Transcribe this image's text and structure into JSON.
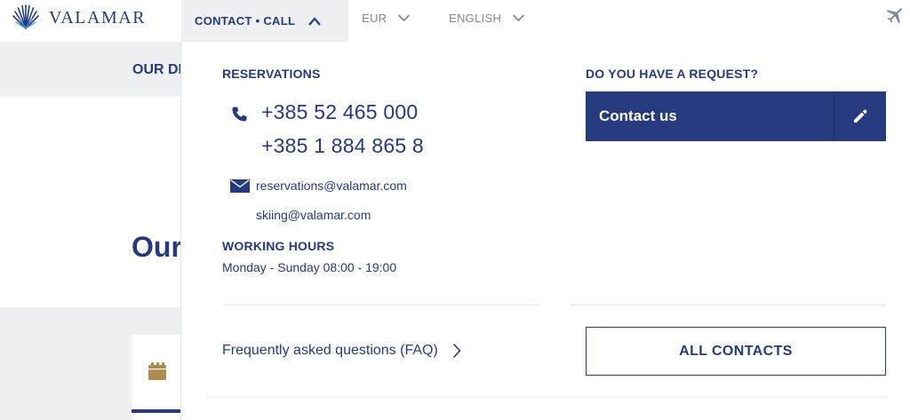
{
  "brand": {
    "name": "VALAMAR"
  },
  "topnav": {
    "contact_label": "CONTACT • CALL",
    "currency_label": "EUR",
    "language_label": "ENGLISH"
  },
  "background": {
    "nav_text": "OUR DESTINATIONS",
    "heading": "Our"
  },
  "dropdown": {
    "reservations": {
      "title": "RESERVATIONS",
      "phones": [
        "+385 52 465 000",
        "+385 1 884 865 8"
      ],
      "emails": [
        "reservations@valamar.com",
        "skiing@valamar.com"
      ]
    },
    "working_hours": {
      "title": "WORKING HOURS",
      "text": "Monday - Sunday 08:00 - 19:00"
    },
    "request": {
      "title": "DO YOU HAVE A REQUEST?",
      "contact_button": "Contact us"
    },
    "faq_label": "Frequently asked questions (FAQ)",
    "all_contacts_button": "ALL CONTACTS"
  },
  "colors": {
    "brand_navy": "#253a7f",
    "muted": "#7c8ba3",
    "panel_bg": "#ffffff",
    "strip_bg": "#eef0f2",
    "accent_gold": "#b08a4e"
  },
  "icons": {
    "logo": "valamar-fan-icon",
    "contact_chevron": "chevron-up-icon",
    "currency_chevron": "chevron-down-icon",
    "language_chevron": "chevron-down-icon",
    "plane": "plane-icon",
    "phone": "phone-icon",
    "mail": "mail-icon",
    "faq_chevron": "chevron-right-icon",
    "contact_button": "pencil-icon",
    "card": "calendar-icon"
  }
}
